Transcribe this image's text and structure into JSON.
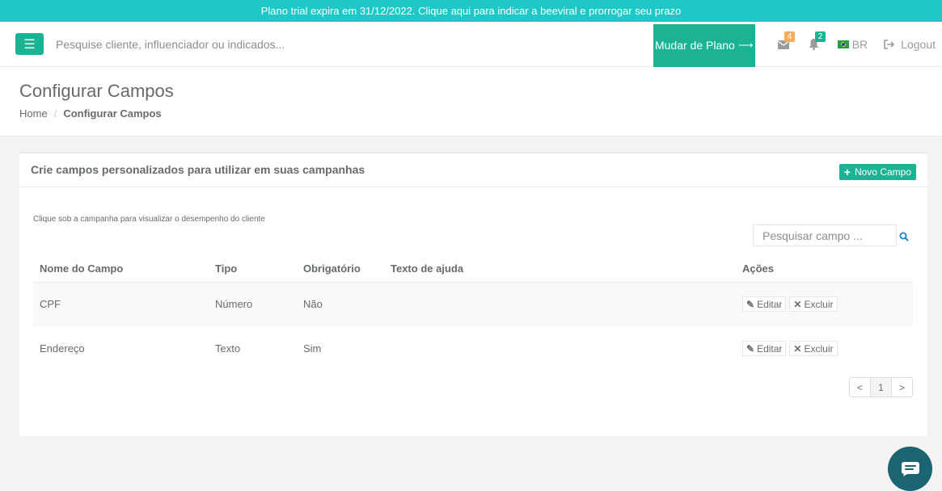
{
  "banner": {
    "text": "Plano trial expira em 31/12/2022. Clique aqui para indicar a beeviral e prorrogar seu prazo"
  },
  "topbar": {
    "search_placeholder": "Pesquise cliente, influenciador ou indicados...",
    "plan_button": "Mudar de Plano",
    "messages_count": "4",
    "notifications_count": "2",
    "language": "BR",
    "logout": "Logout"
  },
  "heading": {
    "title": "Configurar Campos",
    "breadcrumb": [
      {
        "label": "Home"
      },
      {
        "label": "Configurar Campos"
      }
    ]
  },
  "panel": {
    "title": "Crie campos personalizados para utilizar em suas campanhas",
    "new_button": "Novo Campo",
    "hint": "Clique sob a campanha para visualizar o desempenho do cliente",
    "search_placeholder": "Pesquisar campo ..."
  },
  "table": {
    "headers": [
      "Nome do Campo",
      "Tipo",
      "Obrigatório",
      "Texto de ajuda",
      "Ações"
    ],
    "rows": [
      {
        "name": "CPF",
        "type": "Número",
        "required": "Não",
        "help": ""
      },
      {
        "name": "Endereço",
        "type": "Texto",
        "required": "Sim",
        "help": ""
      }
    ],
    "edit_label": "Editar",
    "delete_label": "Excluir"
  },
  "pagination": {
    "prev": "<",
    "current": "1",
    "next": ">"
  },
  "colors": {
    "banner": "#1ec8c8",
    "primary": "#1ab394",
    "chat": "#1a6571"
  }
}
